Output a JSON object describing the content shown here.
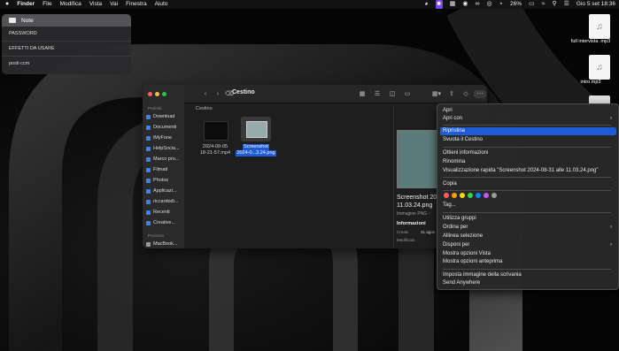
{
  "menubar": {
    "apple": "",
    "app": "Finder",
    "items": [
      "File",
      "Modifica",
      "Vista",
      "Vai",
      "Finestra",
      "Aiuto"
    ],
    "battery": "26%",
    "clock": "Gio 5 set  18:36"
  },
  "notes": {
    "title": "Note",
    "items": [
      "PASSWORD",
      "EFFETTI DA USARE",
      "posti ccm"
    ]
  },
  "desktop_files": [
    {
      "label": "full intervista .mp3"
    },
    {
      "label": "intro.mp3"
    }
  ],
  "finder": {
    "title": "Cestino",
    "path_label": "Cestino",
    "sidebar_heading_favorites": "Preferiti",
    "sidebar_items": [
      "Download",
      "Documenti",
      "iMyFone",
      "HelpSocia...",
      "Marco pro...",
      "Filmati",
      "Photos",
      "Applicazi...",
      "riccardodi...",
      "Recenti",
      "Creative..."
    ],
    "sidebar_heading_locations": "Posizioni",
    "sidebar_locations": [
      "MacBook..."
    ],
    "files": [
      {
        "name_line1": "2024-09-05",
        "name_line2": "18-21-57.mp4"
      },
      {
        "name_line1": "Screenshot",
        "name_line2": "2024-0...3.24.png"
      }
    ],
    "preview": {
      "title_line1": "Screenshot 20",
      "title_line2": "11.03.24.png",
      "kind": "Immagine PNG -",
      "info_heading": "Informazioni",
      "created_label": "Creato",
      "created_value": "31 agos",
      "modified_label": "Modificato"
    }
  },
  "context_menu": {
    "items": [
      {
        "label": "Apri"
      },
      {
        "label": "Apri con"
      },
      {
        "label": "Ripristina"
      },
      {
        "label": "Svuota il Cestino"
      },
      {
        "label": "Ottieni informazioni"
      },
      {
        "label": "Rinomina"
      },
      {
        "label": "Visualizzazione rapida \"Screenshot 2024-08-31 alle 11.03.24.png\""
      },
      {
        "label": "Copia"
      },
      {
        "label": "Tag..."
      },
      {
        "label": "Utilizza gruppi"
      },
      {
        "label": "Ordina per"
      },
      {
        "label": "Allinea selezione"
      },
      {
        "label": "Disponi per"
      },
      {
        "label": "Mostra opzioni Vista"
      },
      {
        "label": "Mostra opzioni anteprima"
      },
      {
        "label": "Imposta immagine della scrivania"
      },
      {
        "label": "Send Anywhere"
      }
    ],
    "tag_colors": [
      "#ff5f57",
      "#ff9f0a",
      "#ffd60a",
      "#32d74b",
      "#0a84ff",
      "#bf5af2",
      "#98989d"
    ]
  }
}
